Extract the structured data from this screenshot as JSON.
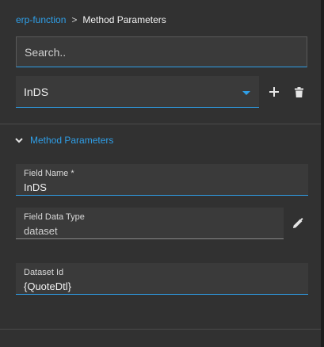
{
  "breadcrumb": {
    "parent": "erp-function",
    "separator": ">",
    "current": "Method Parameters"
  },
  "search": {
    "placeholder": "Search..",
    "value": ""
  },
  "selector": {
    "selected": "InDS",
    "caret_icon": "dropdown-caret-icon"
  },
  "toolbar": {
    "add_icon": "plus-icon",
    "delete_icon": "trash-icon"
  },
  "section": {
    "title": "Method Parameters",
    "expanded": true,
    "toggle_icon": "chevron-down-icon"
  },
  "fields": {
    "field_name": {
      "label": "Field Name",
      "required_marker": "*",
      "value": "InDS"
    },
    "field_data_type": {
      "label": "Field Data Type",
      "value": "dataset",
      "edit_icon": "pencil-icon"
    },
    "dataset_id": {
      "label": "Dataset Id",
      "value": "{QuoteDtl}"
    }
  },
  "colors": {
    "accent": "#2f9fe8",
    "panel_background": "#313131",
    "input_background": "#3a3a3a",
    "divider": "#4a4a4a"
  }
}
